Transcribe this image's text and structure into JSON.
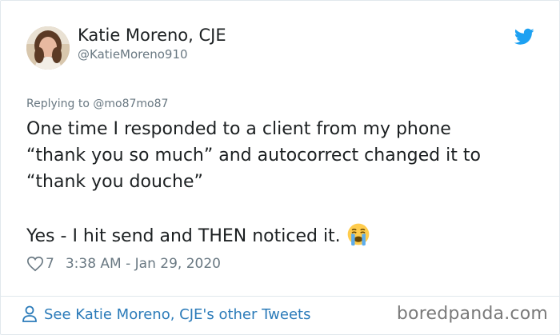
{
  "author": {
    "display_name": "Katie Moreno, CJE",
    "handle": "@KatieMoreno910"
  },
  "tweet": {
    "replying_to": "Replying to @mo87mo87",
    "lines": [
      "One time I responded to a client from my phone",
      "“thank you so much” and autocorrect changed it to",
      "“thank you douche”",
      "",
      "Yes - I hit send and THEN noticed it."
    ],
    "emoji": "loudly-crying-face",
    "likes": "7",
    "timestamp": "3:38 AM - Jan 29, 2020"
  },
  "footer": {
    "see_more": "See Katie Moreno, CJE's other Tweets",
    "watermark": "boredpanda.com"
  },
  "colors": {
    "link": "#2b7bb9",
    "twitter_blue": "#1da1f2",
    "secondary_text": "#697882",
    "border": "#e1e8ed"
  },
  "icons": [
    "twitter-bird-icon",
    "heart-icon",
    "user-icon",
    "crying-emoji-icon"
  ]
}
